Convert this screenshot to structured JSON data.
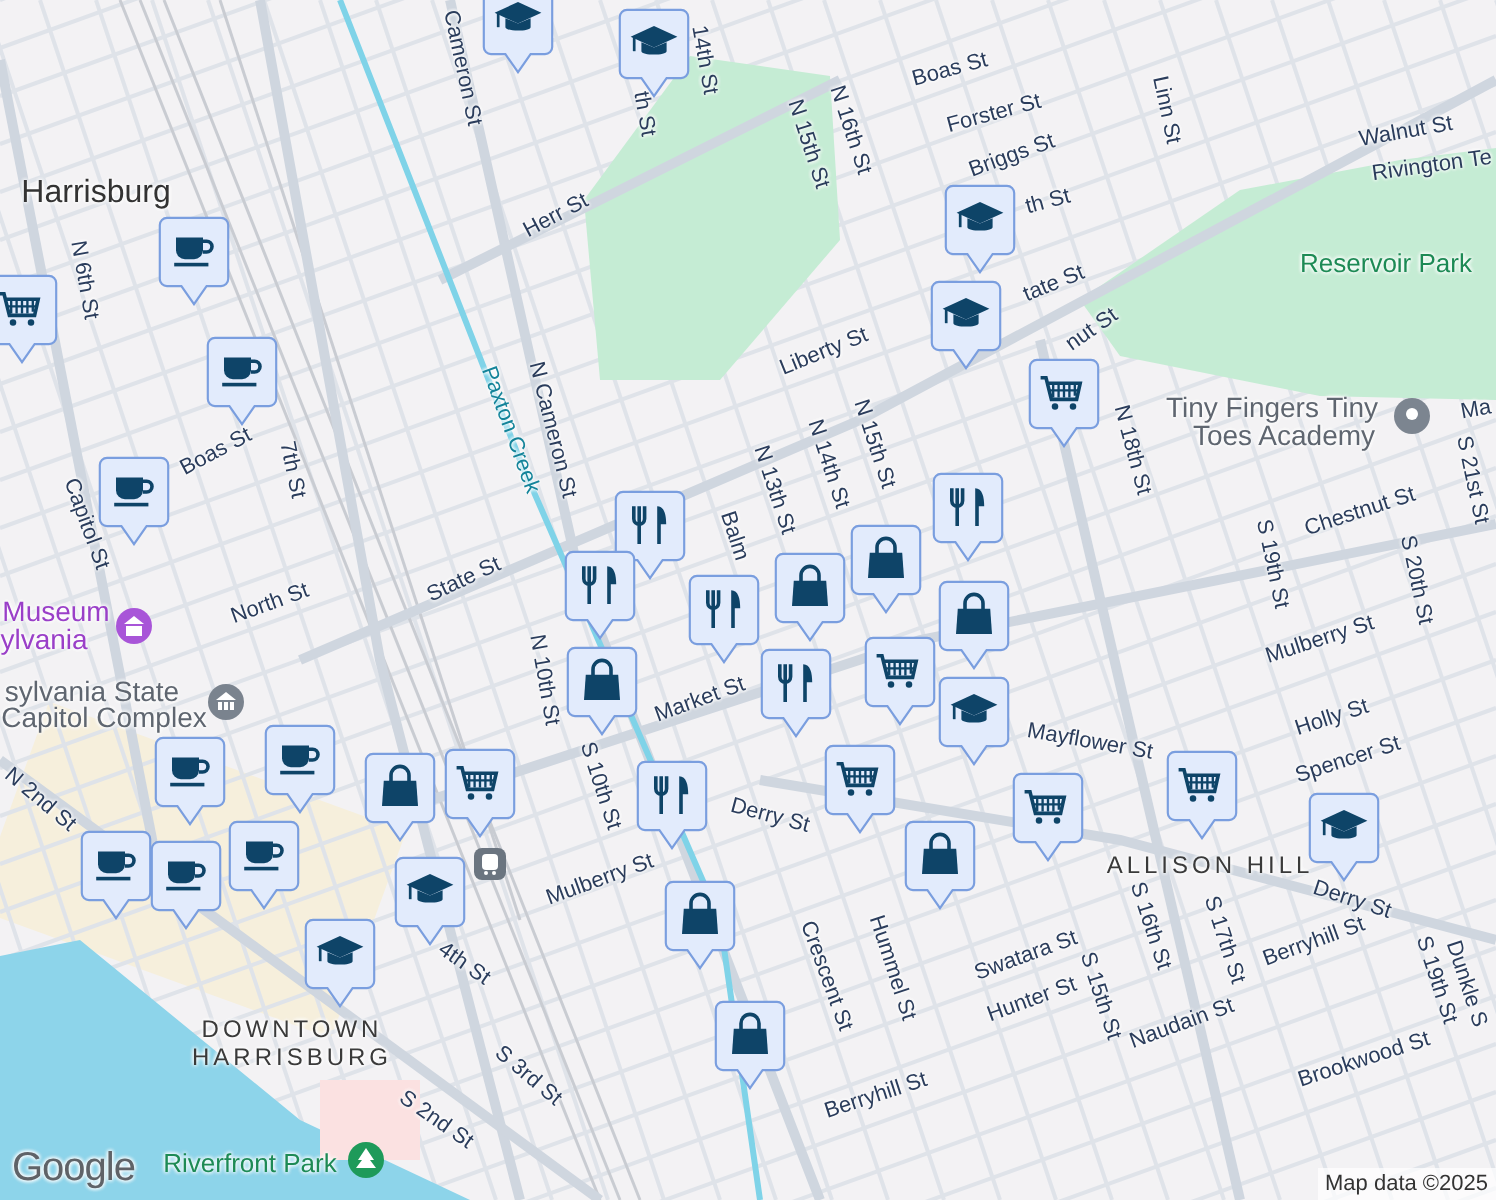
{
  "map": {
    "labels": [
      {
        "text": "Cameron St",
        "kind": "street"
      },
      {
        "text": "14th St",
        "kind": "street"
      },
      {
        "text": "th St",
        "kind": "street"
      },
      {
        "text": "Boas St",
        "kind": "street"
      },
      {
        "text": "N 16th St",
        "kind": "street"
      },
      {
        "text": "Forster St",
        "kind": "street"
      },
      {
        "text": "Linn St",
        "kind": "street"
      },
      {
        "text": "Walnut St",
        "kind": "street"
      },
      {
        "text": "Rivington Te",
        "kind": "street"
      },
      {
        "text": "Herr St",
        "kind": "street"
      },
      {
        "text": "Harrisburg",
        "kind": "city"
      },
      {
        "text": "N 15th St",
        "kind": "street"
      },
      {
        "text": "Briggs St",
        "kind": "street"
      },
      {
        "text": "th St",
        "kind": "street"
      },
      {
        "text": "Reservoir Park",
        "kind": "park"
      },
      {
        "text": "N 6th St",
        "kind": "street"
      },
      {
        "text": "Liberty St",
        "kind": "street"
      },
      {
        "text": "tate St",
        "kind": "street"
      },
      {
        "text": "nut St",
        "kind": "street"
      },
      {
        "text": "Paxton Creek",
        "kind": "water"
      },
      {
        "text": "N Cameron St",
        "kind": "street"
      },
      {
        "text": "Boas St",
        "kind": "street"
      },
      {
        "text": "7th St",
        "kind": "street"
      },
      {
        "text": "Capitol St",
        "kind": "street"
      },
      {
        "text": "Tiny Fingers Tiny",
        "kind": "place"
      },
      {
        "text": "Toes Academy",
        "kind": "place"
      },
      {
        "text": "Ma",
        "kind": "street"
      },
      {
        "text": "N 18th St",
        "kind": "street"
      },
      {
        "text": "N 13th St",
        "kind": "street"
      },
      {
        "text": "N 14th St",
        "kind": "street"
      },
      {
        "text": "N 15th St",
        "kind": "street"
      },
      {
        "text": "S 21st St",
        "kind": "street"
      },
      {
        "text": "Chestnut St",
        "kind": "street"
      },
      {
        "text": "Balm",
        "kind": "street"
      },
      {
        "text": "S 19th St",
        "kind": "street"
      },
      {
        "text": "S 20th St",
        "kind": "street"
      },
      {
        "text": "State St",
        "kind": "street"
      },
      {
        "text": "North St",
        "kind": "street"
      },
      {
        "text": "Museum",
        "kind": "museum"
      },
      {
        "text": "ylvania",
        "kind": "museum"
      },
      {
        "text": "sylvania State",
        "kind": "place"
      },
      {
        "text": "Capitol Complex",
        "kind": "place"
      },
      {
        "text": "N 10th St",
        "kind": "street"
      },
      {
        "text": "Market St",
        "kind": "street"
      },
      {
        "text": "Mulberry St",
        "kind": "street"
      },
      {
        "text": "Holly St",
        "kind": "street"
      },
      {
        "text": "Spencer St",
        "kind": "street"
      },
      {
        "text": "Mayflower St",
        "kind": "street"
      },
      {
        "text": "N 2nd St",
        "kind": "street"
      },
      {
        "text": "S 10th St",
        "kind": "street"
      },
      {
        "text": "Derry St",
        "kind": "street"
      },
      {
        "text": "ALLISON HILL",
        "kind": "district"
      },
      {
        "text": "Derry St",
        "kind": "street"
      },
      {
        "text": "Mulberry St",
        "kind": "street"
      },
      {
        "text": "4th St",
        "kind": "street"
      },
      {
        "text": "Berryhill St",
        "kind": "street"
      },
      {
        "text": "S 19th St",
        "kind": "street"
      },
      {
        "text": "Dunkle S",
        "kind": "street"
      },
      {
        "text": "S 16th St",
        "kind": "street"
      },
      {
        "text": "S 17th St",
        "kind": "street"
      },
      {
        "text": "Swatara St",
        "kind": "street"
      },
      {
        "text": "Crescent St",
        "kind": "street"
      },
      {
        "text": "Hummel St",
        "kind": "street"
      },
      {
        "text": "Hunter St",
        "kind": "street"
      },
      {
        "text": "S 15th St",
        "kind": "street"
      },
      {
        "text": "DOWNTOWN",
        "kind": "district"
      },
      {
        "text": "HARRISBURG",
        "kind": "district"
      },
      {
        "text": "Naudain St",
        "kind": "street"
      },
      {
        "text": "Brookwood St",
        "kind": "street"
      },
      {
        "text": "S 3rd St",
        "kind": "street"
      },
      {
        "text": "Berryhill St",
        "kind": "street"
      },
      {
        "text": "S 2nd St",
        "kind": "street"
      },
      {
        "text": "Riverfront Park",
        "kind": "park"
      }
    ],
    "pins": [
      {
        "kind": "school"
      },
      {
        "kind": "school"
      },
      {
        "kind": "school"
      },
      {
        "kind": "school"
      },
      {
        "kind": "grocery"
      },
      {
        "kind": "coffee"
      },
      {
        "kind": "coffee"
      },
      {
        "kind": "grocery"
      },
      {
        "kind": "coffee"
      },
      {
        "kind": "restaurant"
      },
      {
        "kind": "restaurant"
      },
      {
        "kind": "shop"
      },
      {
        "kind": "shop"
      },
      {
        "kind": "restaurant"
      },
      {
        "kind": "shop"
      },
      {
        "kind": "restaurant"
      },
      {
        "kind": "shop"
      },
      {
        "kind": "restaurant"
      },
      {
        "kind": "school"
      },
      {
        "kind": "grocery"
      },
      {
        "kind": "grocery"
      },
      {
        "kind": "grocery"
      },
      {
        "kind": "restaurant"
      },
      {
        "kind": "shop"
      },
      {
        "kind": "shop"
      },
      {
        "kind": "grocery"
      },
      {
        "kind": "school"
      },
      {
        "kind": "coffee"
      },
      {
        "kind": "coffee"
      },
      {
        "kind": "shop"
      },
      {
        "kind": "coffee"
      },
      {
        "kind": "school"
      },
      {
        "kind": "grocery"
      },
      {
        "kind": "coffee"
      },
      {
        "kind": "coffee"
      },
      {
        "kind": "school"
      },
      {
        "kind": "shop"
      }
    ]
  },
  "attribution": {
    "logo": "Google",
    "copyright": "Map data ©2025"
  }
}
